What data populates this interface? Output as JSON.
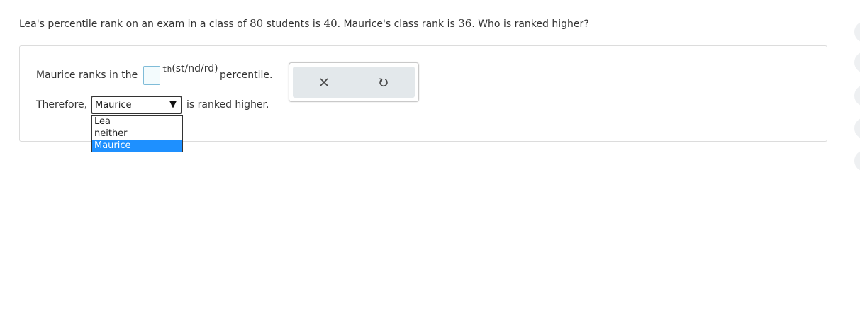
{
  "question": {
    "part1": "Lea's percentile rank on an exam in a class of ",
    "num1": "80",
    "part2": " students is ",
    "num2": "40",
    "part3": ". Maurice's class rank is ",
    "num3": "36",
    "part4": ". Who is ranked higher?"
  },
  "answer": {
    "line1_prefix": "Maurice ranks in the",
    "percentile_input_value": "",
    "ordinal_suffix": "th",
    "ordinal_options": "(st/nd/rd)",
    "line1_suffix": "percentile.",
    "line2_prefix": "Therefore,",
    "select_value": "Maurice",
    "select_arrow": "▼",
    "line2_suffix": "is ranked higher.",
    "dropdown_options": [
      "Lea",
      "neither",
      "Maurice"
    ],
    "dropdown_selected": "Maurice"
  },
  "tools": {
    "clear_icon": "x-icon",
    "undo_icon": "undo-icon"
  },
  "colors": {
    "selected_option_bg": "#1e90ff",
    "tool_panel_bg": "#e3e8eb",
    "input_border": "#7fbcd8"
  }
}
